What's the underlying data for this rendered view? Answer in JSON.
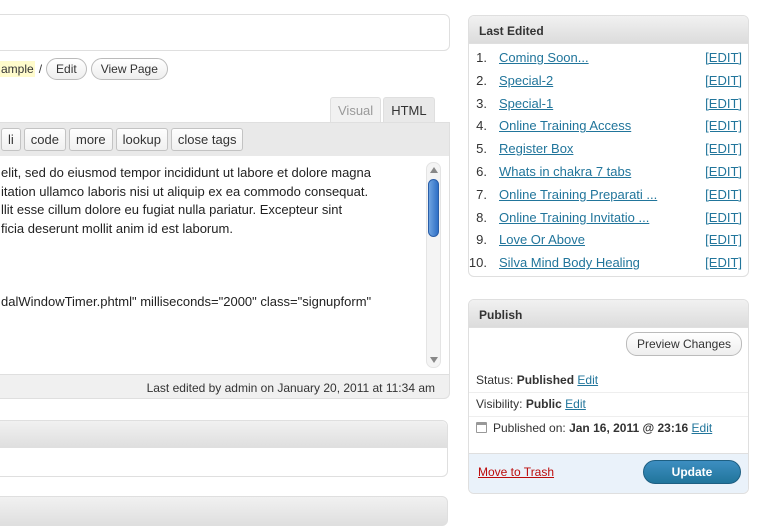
{
  "permalink": {
    "slug_fragment": "ample",
    "separator": "/",
    "edit_label": "Edit",
    "view_page_label": "View Page"
  },
  "editor": {
    "tabs": [
      "Visual",
      "HTML"
    ],
    "active_tab": "HTML",
    "quicktags": [
      "li",
      "code",
      "more",
      "lookup",
      "close tags"
    ],
    "lines": [
      "elit, sed do eiusmod tempor incididunt ut labore et dolore magna",
      "itation ullamco laboris nisi ut aliquip ex ea commodo consequat.",
      "llit esse cillum dolore eu fugiat nulla pariatur. Excepteur sint",
      "ficia deserunt mollit anim id est laborum.",
      "dalWindowTimer.phtml\" milliseconds=\"2000\" class=\"signupform\""
    ],
    "status_text": "Last edited by admin on January 20, 2011 at 11:34 am"
  },
  "last_edited": {
    "title": "Last Edited",
    "edit_label": "[EDIT]",
    "items": [
      {
        "num": "1.",
        "label": "Coming Soon..."
      },
      {
        "num": "2.",
        "label": "Special-2"
      },
      {
        "num": "3.",
        "label": "Special-1"
      },
      {
        "num": "4.",
        "label": "Online Training Access"
      },
      {
        "num": "5.",
        "label": "Register Box"
      },
      {
        "num": "6.",
        "label": "Whats in chakra 7 tabs"
      },
      {
        "num": "7.",
        "label": "Online Training Preparati ..."
      },
      {
        "num": "8.",
        "label": "Online Training Invitatio ..."
      },
      {
        "num": "9.",
        "label": "Love Or Above"
      },
      {
        "num": "10.",
        "label": "Silva Mind Body Healing"
      }
    ]
  },
  "publish": {
    "title": "Publish",
    "preview_label": "Preview Changes",
    "status_label": "Status:",
    "status_value": "Published",
    "visibility_label": "Visibility:",
    "visibility_value": "Public",
    "published_label": "Published on:",
    "published_value": "Jan 16, 2011 @ 23:16",
    "edit_link": "Edit",
    "trash_label": "Move to Trash",
    "update_label": "Update"
  },
  "colors": {
    "link": "#21759b",
    "trash": "#bc0b0b",
    "update_button": "#21759b",
    "slug_highlight": "#fffbcc"
  }
}
